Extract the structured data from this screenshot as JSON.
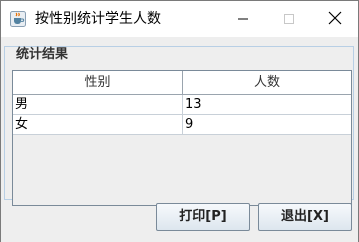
{
  "window": {
    "title": "按性别统计学生人数",
    "icons": {
      "app": "java-cup-icon",
      "minimize": "minimize-icon",
      "maximize": "maximize-icon",
      "close": "close-icon"
    }
  },
  "group": {
    "label": "统计结果"
  },
  "table": {
    "headers": [
      "性别",
      "人数"
    ],
    "rows": [
      [
        "男",
        "13"
      ],
      [
        "女",
        "9"
      ]
    ]
  },
  "buttons": {
    "print": "打印[P]",
    "exit": "退出[X]"
  },
  "colors": {
    "background": "#eeeeee",
    "group_border": "#b8cfe5",
    "table_border": "#7a8a99"
  }
}
